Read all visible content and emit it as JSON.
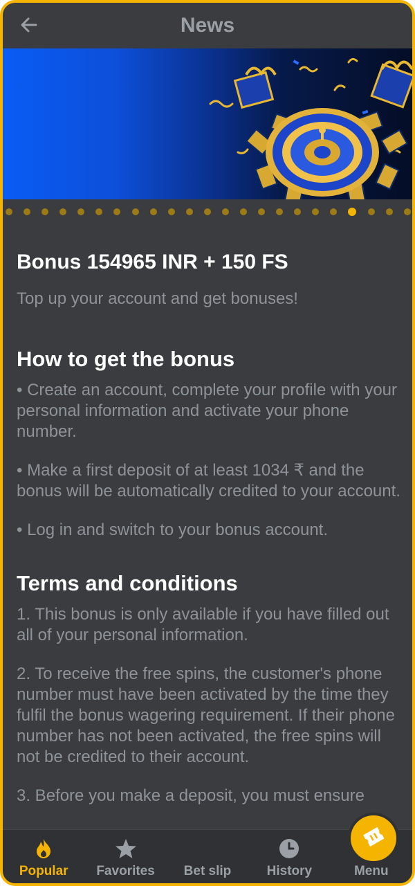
{
  "header": {
    "title": "News",
    "back_icon": "arrow-left-icon"
  },
  "carousel": {
    "total": 23,
    "active_index": 19
  },
  "article": {
    "title": "Bonus 154965 INR + 150 FS",
    "subtitle": "Top up your account and get bonuses!",
    "section1": {
      "heading": "How to get the bonus",
      "items": [
        "• Create an account, complete your profile with your personal information and activate your phone number.",
        "• Make a first deposit of at least 1034 ₹ and the bonus will be automatically credited to your account.",
        "• Log in and switch to your bonus account."
      ]
    },
    "section2": {
      "heading": "Terms and conditions",
      "items": [
        "1. This bonus is only available if you have filled out all of your personal information.",
        "2. To receive the free spins, the customer's phone number must have been activated by the time they fulfil the bonus wagering requirement. If their phone number has not been activated, the free spins will not be credited to their account.",
        "3. Before you make a deposit, you must ensure"
      ]
    }
  },
  "bottom_nav": {
    "items": [
      {
        "label": "Popular",
        "icon": "flame-icon",
        "active": true
      },
      {
        "label": "Favorites",
        "icon": "star-icon",
        "active": false
      },
      {
        "label": "Bet slip",
        "icon": "ticket-icon",
        "active": false
      },
      {
        "label": "History",
        "icon": "clock-icon",
        "active": false
      },
      {
        "label": "Menu",
        "icon": "grid-icon",
        "active": false
      }
    ]
  },
  "colors": {
    "accent": "#f5b400",
    "background": "#3a3c3f",
    "text_muted": "#8e939a"
  }
}
